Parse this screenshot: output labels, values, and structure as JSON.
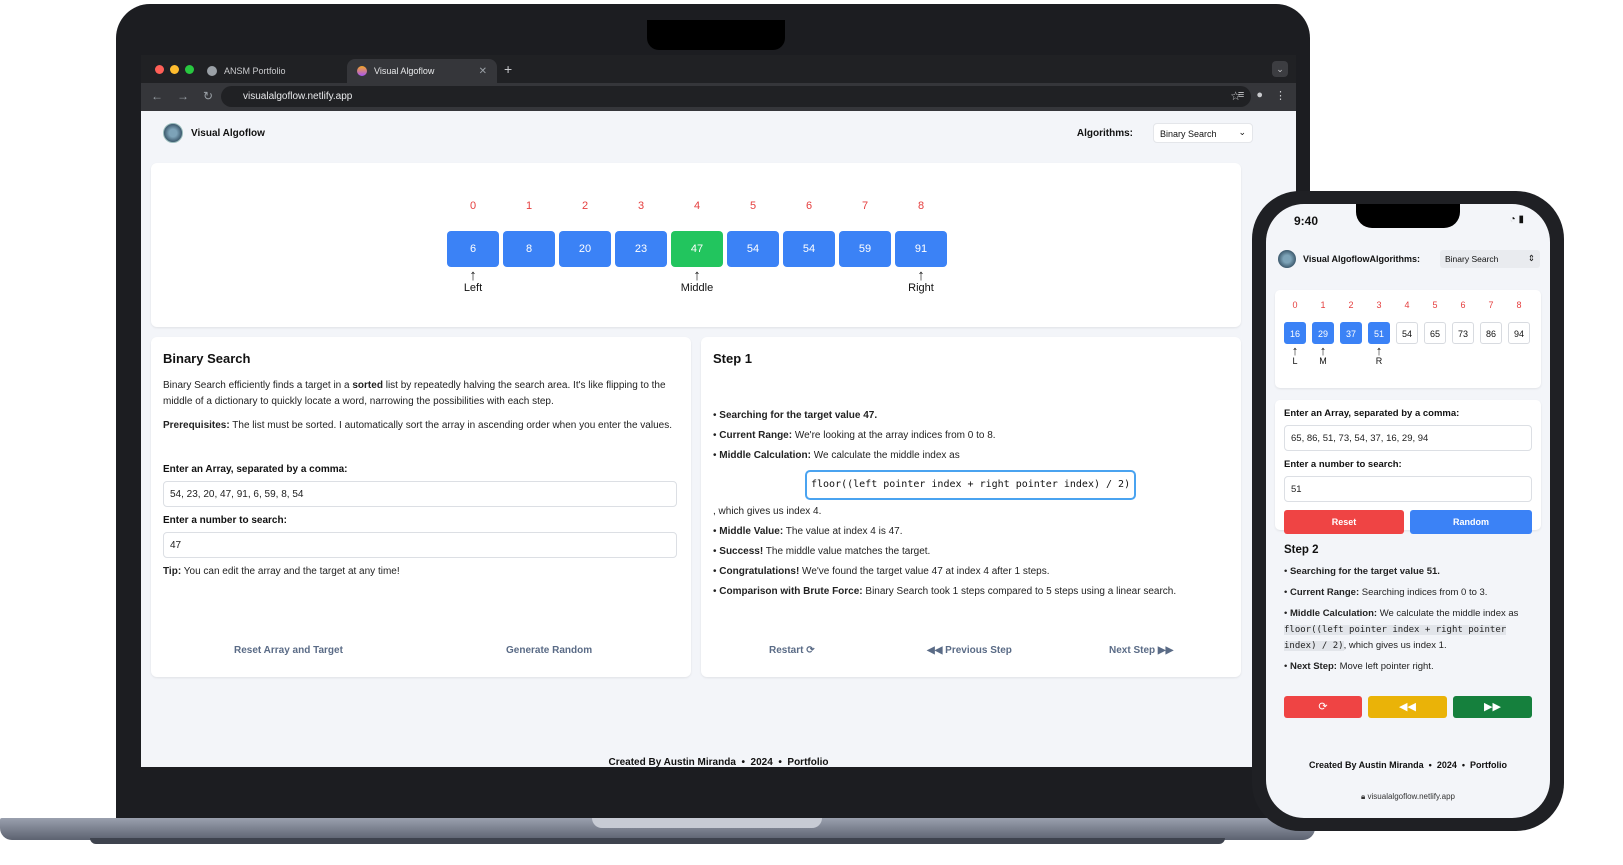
{
  "browser": {
    "tabs": [
      {
        "label": "ANSM Portfolio"
      },
      {
        "label": "Visual Algoflow"
      }
    ],
    "url": "visualalgoflow.netlify.app"
  },
  "app": {
    "brand": "Visual Algoflow",
    "algorithms_label": "Algorithms:",
    "algorithm_selected": "Binary Search"
  },
  "viz": {
    "indices": [
      "0",
      "1",
      "2",
      "3",
      "4",
      "5",
      "6",
      "7",
      "8"
    ],
    "values": [
      "6",
      "8",
      "20",
      "23",
      "47",
      "54",
      "54",
      "59",
      "91"
    ],
    "found_index": 4,
    "pointers": {
      "left": "Left",
      "middle": "Middle",
      "right": "Right"
    }
  },
  "info": {
    "title": "Binary Search",
    "desc_pre": "Binary Search efficiently finds a target in a ",
    "desc_bold": "sorted",
    "desc_post": " list by repeatedly halving the search area. It's like flipping to the middle of a dictionary to quickly locate a word, narrowing the possibilities with each step.",
    "prereq_label": "Prerequisites:",
    "prereq_text": " The list must be sorted. I automatically sort the array in ascending order when you enter the values.",
    "array_label": "Enter an Array, separated by a comma:",
    "array_value": "54, 23, 20, 47, 91, 6, 59, 8, 54",
    "target_label": "Enter a number to search:",
    "target_value": "47",
    "tip_label": "Tip:",
    "tip_text": " You can edit the array and the target at any time!",
    "reset_label": "Reset Array and Target",
    "random_label": "Generate Random"
  },
  "steps": {
    "title": "Step 1",
    "s1": "Searching for the target value 47.",
    "s2_label": "Current Range:",
    "s2_text": " We're looking at the array indices from 0 to 8.",
    "s3_label": "Middle Calculation:",
    "s3_text": " We calculate the middle index as",
    "formula": "floor((left pointer index + right pointer index) / 2)",
    "s3_after": ", which gives us index 4.",
    "s4_label": "Middle Value:",
    "s4_text": " The value at index 4 is 47.",
    "s5_label": "Success!",
    "s5_text": " The middle value matches the target.",
    "s6_label": "Congratulations!",
    "s6_text": " We've found the target value 47 at index 4 after 1 steps.",
    "s7_label": "Comparison with Brute Force:",
    "s7_text": " Binary Search took 1 steps compared to 5 steps using a linear search.",
    "restart": "Restart",
    "prev": "Previous Step",
    "next": "Next Step"
  },
  "footer": {
    "author": "Created By Austin Miranda",
    "year": "2024",
    "portfolio": "Portfolio"
  },
  "phone": {
    "time": "9:40",
    "brand": "Visual AlgoflowAlgorithms:",
    "algorithm_selected": "Binary Search",
    "indices": [
      "0",
      "1",
      "2",
      "3",
      "4",
      "5",
      "6",
      "7",
      "8"
    ],
    "values": [
      "16",
      "29",
      "37",
      "51",
      "54",
      "65",
      "73",
      "86",
      "94"
    ],
    "active_upto": 3,
    "pointers": {
      "left": "L",
      "middle": "M",
      "right": "R"
    },
    "array_label": "Enter an Array, separated by a comma:",
    "array_value": "65, 86, 51, 73, 54, 37, 16, 29, 94",
    "target_label": "Enter a number to search:",
    "target_value": "51",
    "reset": "Reset",
    "random": "Random",
    "step_title": "Step 2",
    "s1": "Searching for the target value 51.",
    "s2_label": "Current Range:",
    "s2_text": " Searching indices from 0 to 3.",
    "s3_label": "Middle Calculation:",
    "s3_text": " We calculate the middle index as ",
    "formula": "floor((left pointer index + right pointer index) / 2)",
    "s3_after": ", which gives us index 1.",
    "s4_label": "Next Step:",
    "s4_text": " Move left pointer right.",
    "url": "visualalgoflow.netlify.app"
  },
  "colors": {
    "blue": "#3b82f6",
    "green": "#22c55e",
    "red": "#ef4444",
    "yellow": "#eab308",
    "dark_green": "#15803d"
  }
}
